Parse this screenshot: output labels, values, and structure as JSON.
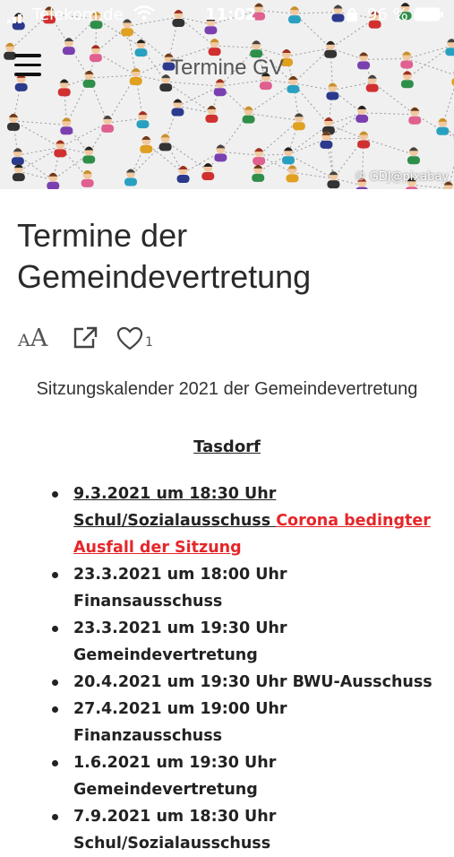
{
  "status": {
    "carrier": "Telekom.de",
    "time": "11:02",
    "battery": "96 %"
  },
  "header": {
    "title": "Termine GV",
    "credit": "© GDJ@pixabay"
  },
  "article": {
    "title": "Termine der Gemeindevertretung",
    "font_size_small": "A",
    "font_size_big": "A",
    "like_count": "1",
    "subtitle": "Sitzungskalender 2021 der Gemeindevertretung",
    "section": "Tasdorf",
    "events": [
      {
        "text": "9.3.2021 um 18:30 Uhr Schul/Sozialausschuss ",
        "note": "Corona bedingter Ausfall der Sitzung"
      },
      {
        "text": "23.3.2021 um 18:00 Uhr Finansausschuss"
      },
      {
        "text": "23.3.2021 um 19:30 Uhr Gemeindevertretung"
      },
      {
        "text": "20.4.2021 um 19:30 Uhr BWU-Ausschuss"
      },
      {
        "text": "27.4.2021 um 19:00 Uhr Finanzausschuss"
      },
      {
        "text": "1.6.2021 um 19:30 Uhr Gemeindevertretung"
      },
      {
        "text": "7.9.2021 um 18:30 Uhr Schul/Sozialausschuss"
      }
    ]
  },
  "colors": {
    "cancelled": "#e5262a"
  }
}
